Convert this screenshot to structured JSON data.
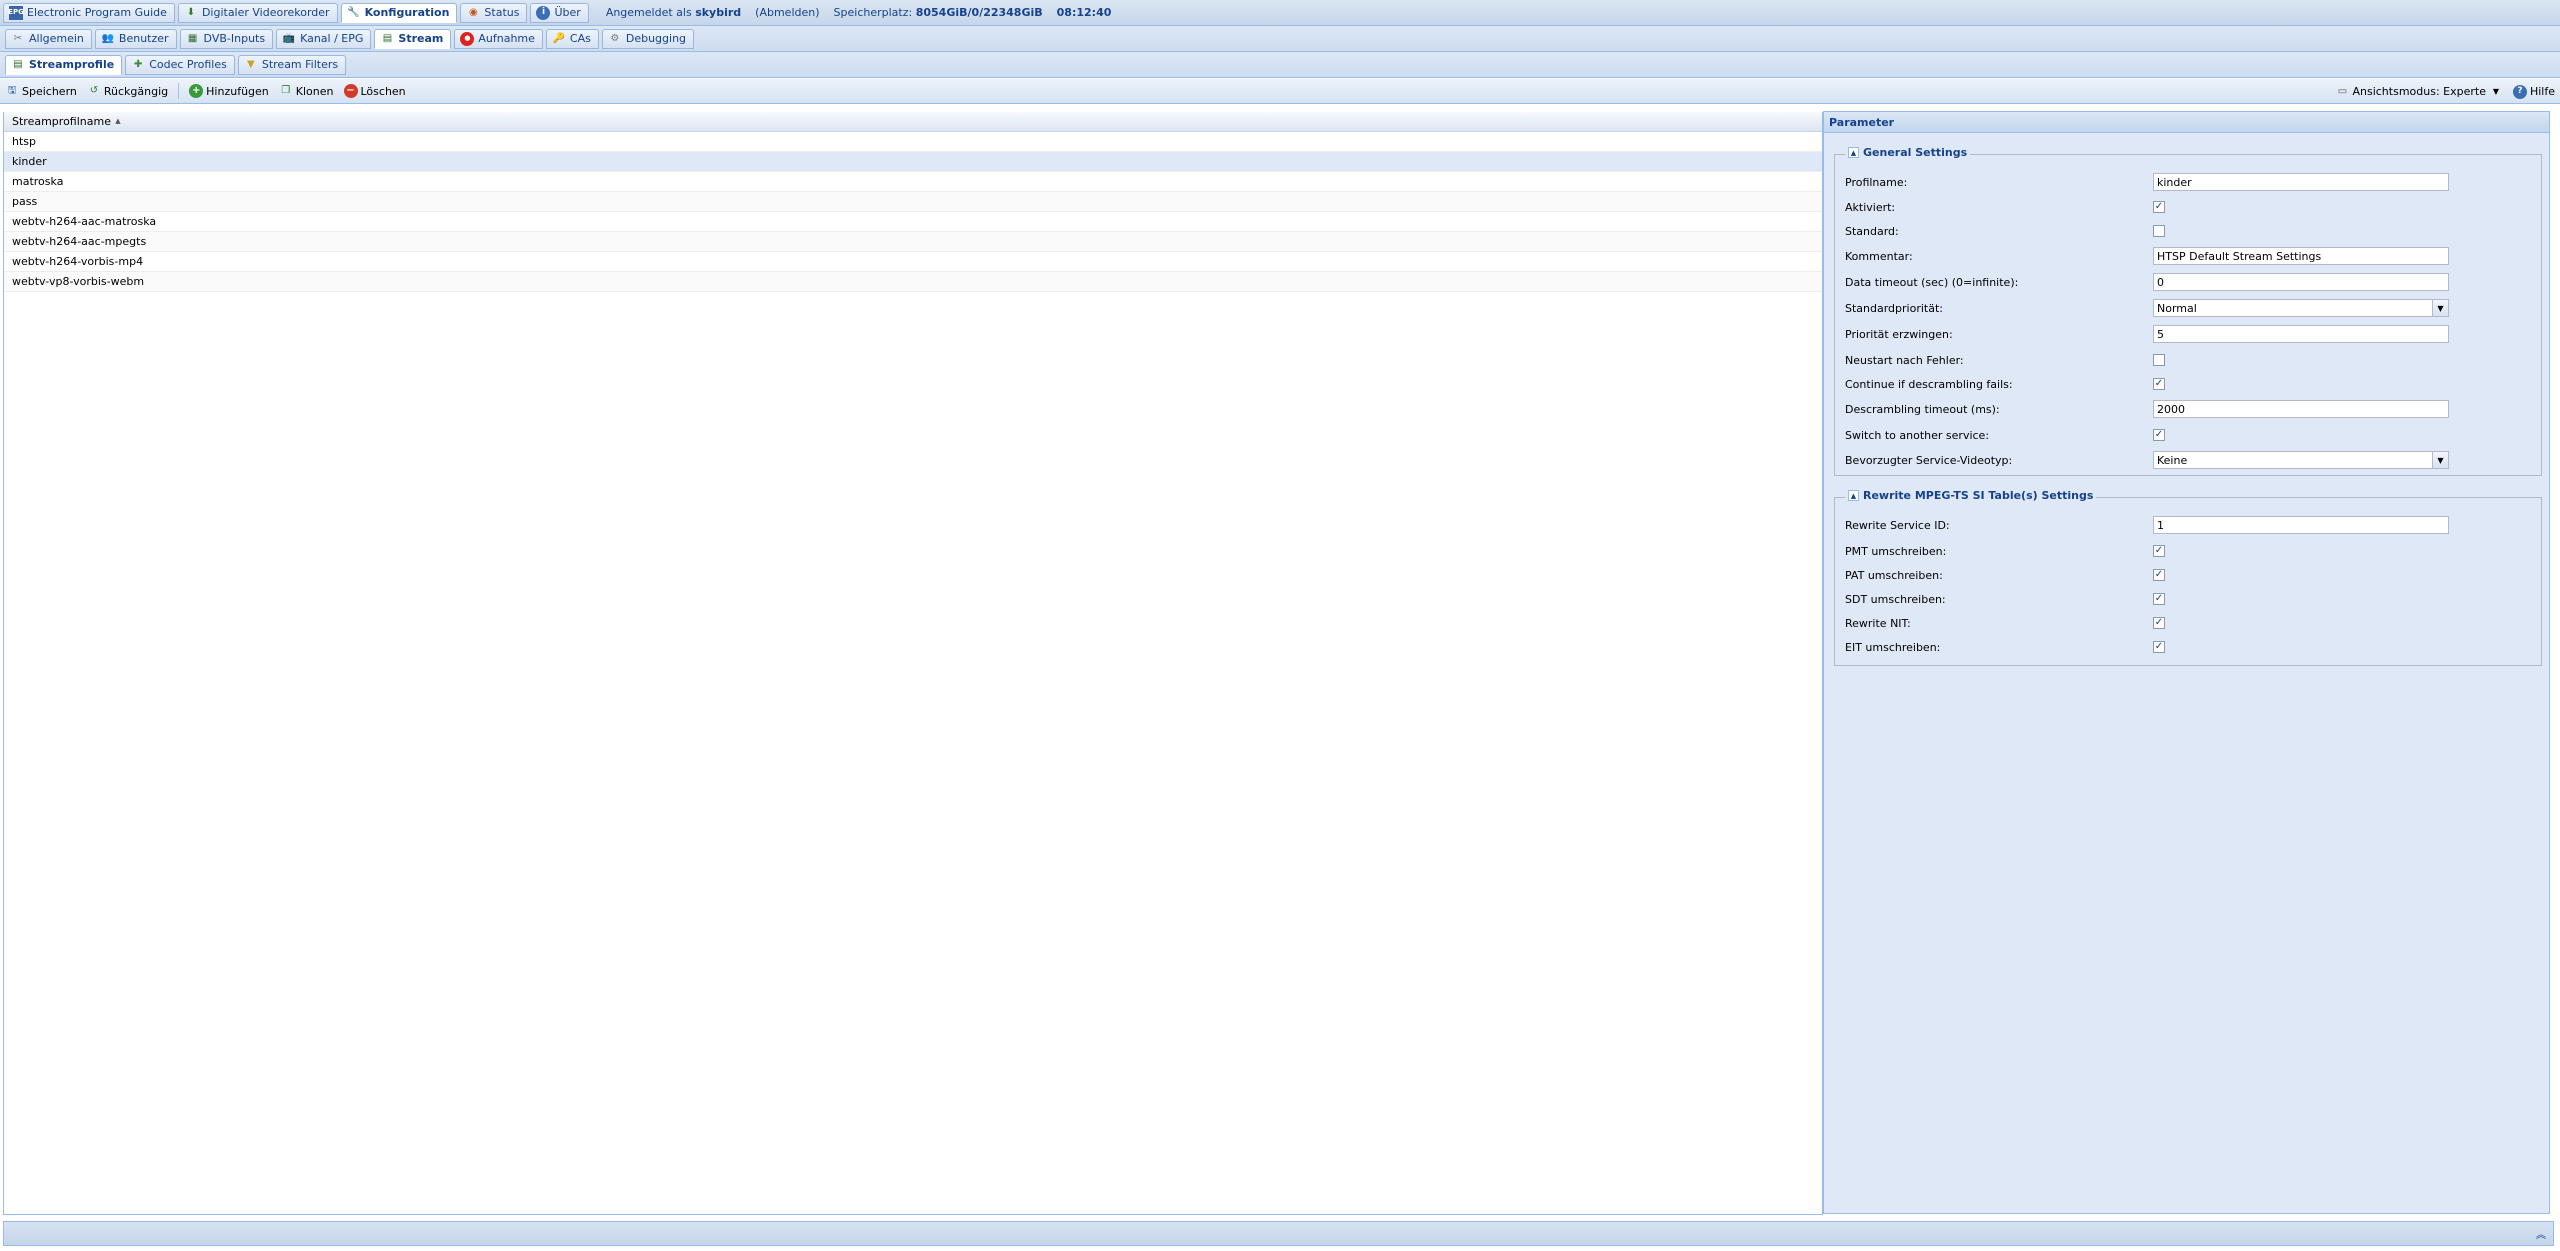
{
  "tabs_main": [
    {
      "label": "Electronic Program Guide",
      "icon": "epg-icon"
    },
    {
      "label": "Digitaler Videorekorder",
      "icon": "dvr-icon"
    },
    {
      "label": "Konfiguration",
      "icon": "wrench-icon"
    },
    {
      "label": "Status",
      "icon": "status-icon"
    },
    {
      "label": "Über",
      "icon": "info-icon"
    }
  ],
  "status": {
    "logged_in_prefix": "Angemeldet als",
    "user": "skybird",
    "logout": "(Abmelden)",
    "storage_label": "Speicherplatz:",
    "storage_value": "8054GiB/0/22348GiB",
    "time": "08:12:40"
  },
  "tabs_config": [
    {
      "label": "Allgemein"
    },
    {
      "label": "Benutzer"
    },
    {
      "label": "DVB-Inputs"
    },
    {
      "label": "Kanal / EPG"
    },
    {
      "label": "Stream"
    },
    {
      "label": "Aufnahme"
    },
    {
      "label": "CAs"
    },
    {
      "label": "Debugging"
    }
  ],
  "tabs_stream": [
    {
      "label": "Streamprofile"
    },
    {
      "label": "Codec Profiles"
    },
    {
      "label": "Stream Filters"
    }
  ],
  "toolbar": {
    "save": "Speichern",
    "undo": "Rückgängig",
    "add": "Hinzufügen",
    "clone": "Klonen",
    "delete": "Löschen",
    "view_mode": "Ansichtsmodus: Experte",
    "help": "Hilfe"
  },
  "grid": {
    "column": "Streamprofilname",
    "rows": [
      "htsp",
      "kinder",
      "matroska",
      "pass",
      "webtv-h264-aac-matroska",
      "webtv-h264-aac-mpegts",
      "webtv-h264-vorbis-mp4",
      "webtv-vp8-vorbis-webm"
    ],
    "selected_index": 1
  },
  "panel": {
    "title": "Parameter",
    "general": {
      "legend": "General Settings",
      "profile_name_label": "Profilname:",
      "profile_name": "kinder",
      "enabled_label": "Aktiviert:",
      "enabled": true,
      "default_label": "Standard:",
      "default": false,
      "comment_label": "Kommentar:",
      "comment": "HTSP Default Stream Settings",
      "data_timeout_label": "Data timeout (sec) (0=infinite):",
      "data_timeout": "0",
      "default_priority_label": "Standardpriorität:",
      "default_priority": "Normal",
      "force_priority_label": "Priorität erzwingen:",
      "force_priority": "5",
      "restart_label": "Neustart nach Fehler:",
      "restart": false,
      "continue_label": "Continue if descrambling fails:",
      "continue": true,
      "descr_timeout_label": "Descrambling timeout (ms):",
      "descr_timeout": "2000",
      "switch_label": "Switch to another service:",
      "switch": true,
      "video_type_label": "Bevorzugter Service-Videotyp:",
      "video_type": "Keine"
    },
    "rewrite": {
      "legend": "Rewrite MPEG-TS SI Table(s) Settings",
      "service_id_label": "Rewrite Service ID:",
      "service_id": "1",
      "pmt_label": "PMT umschreiben:",
      "pmt": true,
      "pat_label": "PAT umschreiben:",
      "pat": true,
      "sdt_label": "SDT umschreiben:",
      "sdt": true,
      "nit_label": "Rewrite NIT:",
      "nit": true,
      "eit_label": "EIT umschreiben:",
      "eit": true
    }
  },
  "colors": {
    "accent": "#15428b",
    "border": "#99bbe8",
    "panel_bg": "#dfe8f6"
  }
}
